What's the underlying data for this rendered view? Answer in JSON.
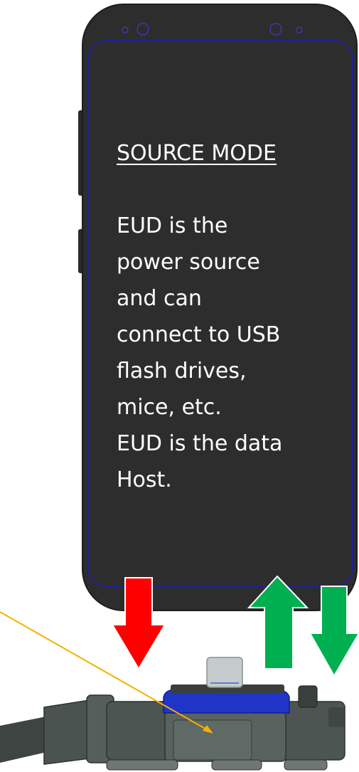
{
  "screen": {
    "title": "SOURCE MODE",
    "description_lines": [
      "EUD is the",
      "power source",
      "and can",
      "connect to USB",
      "flash drives,",
      "mice, etc.",
      "EUD is the data",
      "Host."
    ]
  },
  "colors": {
    "phone_body": "#2d2d2d",
    "screen_outline": "#1a1ad6",
    "power_arrow": "#ff0000",
    "data_arrow": "#00b050",
    "pointer_line": "#f5b000",
    "adapter_band": "#1f35c8",
    "adapter_body": "#4d5552"
  },
  "icons": {
    "power_arrow": "arrow-down",
    "data_up_arrow": "arrow-up",
    "data_down_arrow": "arrow-down"
  }
}
